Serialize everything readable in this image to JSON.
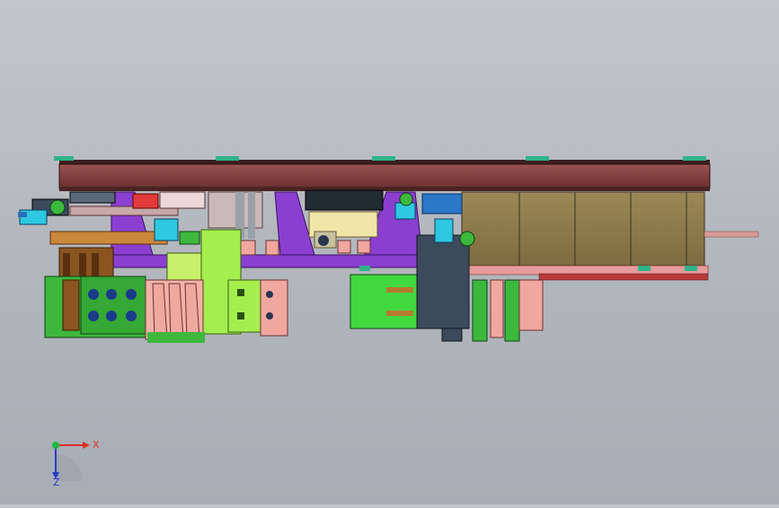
{
  "triad": {
    "x_label": "X",
    "z_label": "Z",
    "x_color": "#e0302a",
    "z_color": "#2a3cc8",
    "y_color": "#1fb83a"
  },
  "colors": {
    "background": "#b4b9bf",
    "beam": "#7b3b3b",
    "frame": "#8b3fd1",
    "tan_panel": "#8d7a4c",
    "lime": "#9ee84a",
    "green": "#3db83d",
    "cyan": "#2ec8e0",
    "salmon": "#f0a7a0",
    "dark_blue": "#3c4a5c"
  }
}
